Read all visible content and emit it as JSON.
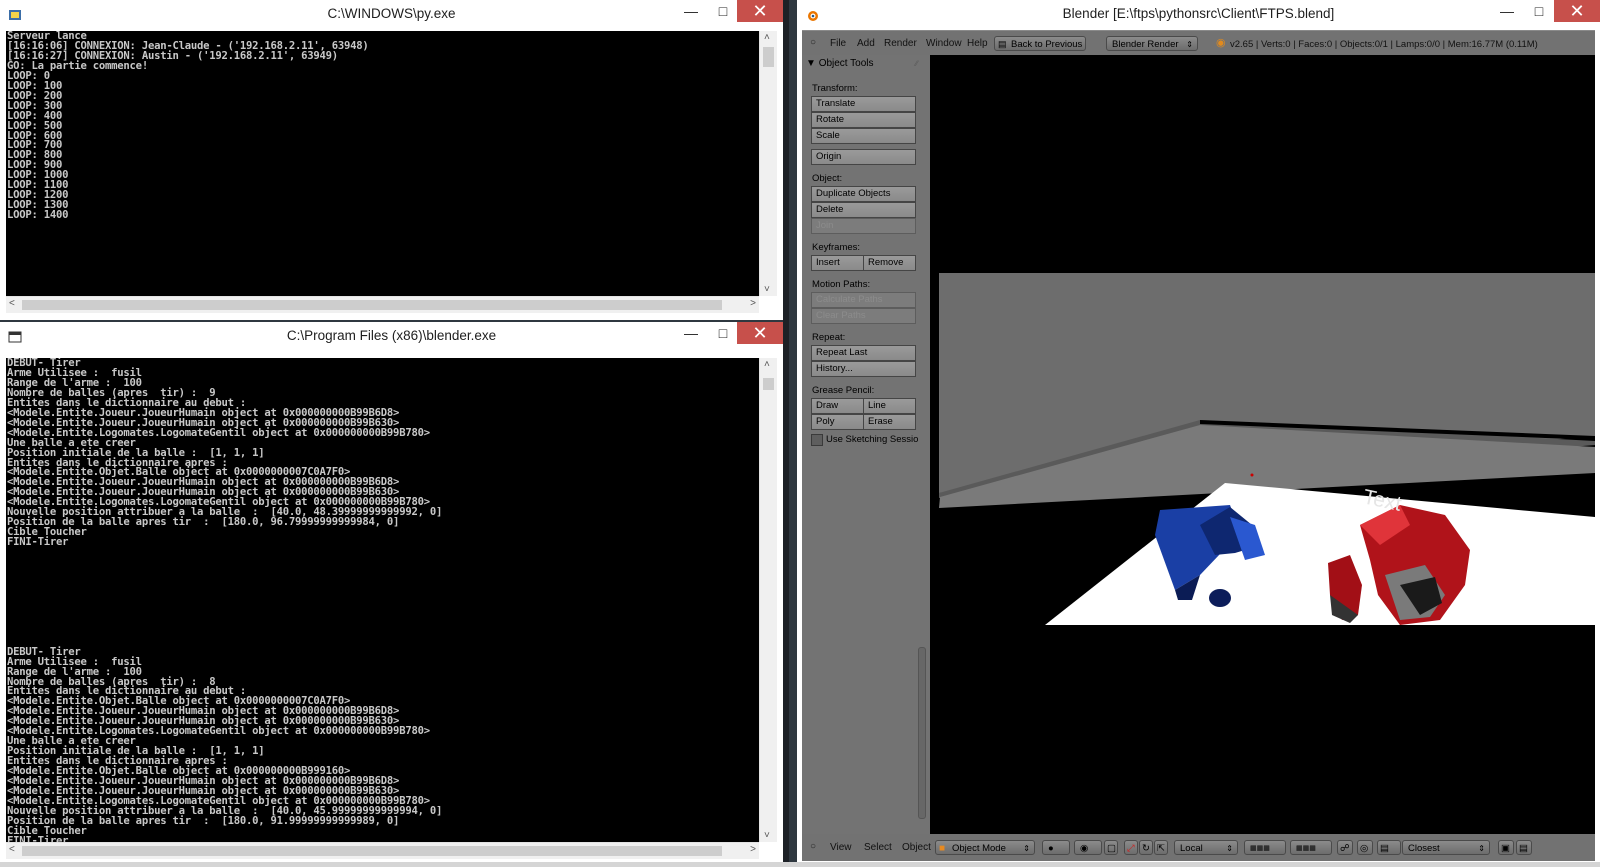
{
  "pywin": {
    "title": "C:\\WINDOWS\\py.exe",
    "lines": [
      "Serveur lance",
      "[16:16:06] CONNEXION: Jean-Claude - ('192.168.2.11', 63948)",
      "[16:16:27] CONNEXION: Austin - ('192.168.2.11', 63949)",
      "GO: La partie commence!",
      "LOOP: 0",
      "LOOP: 100",
      "LOOP: 200",
      "LOOP: 300",
      "LOOP: 400",
      "LOOP: 500",
      "LOOP: 600",
      "LOOP: 700",
      "LOOP: 800",
      "LOOP: 900",
      "LOOP: 1000",
      "LOOP: 1100",
      "LOOP: 1200",
      "LOOP: 1300",
      "LOOP: 1400"
    ]
  },
  "blenderexe": {
    "title": "C:\\Program Files (x86)\\blender.exe",
    "lines": [
      "DEBUT- Tirer",
      "Arme Utilisee :  fusil",
      "Range de l'arme :  100",
      "Nombre de balles (apres  tir) :  9",
      "Entites dans le dictionnaire au debut :",
      "<Modele.Entite.Joueur.JoueurHumain object at 0x000000000B99B6D8>",
      "<Modele.Entite.Joueur.JoueurHumain object at 0x000000000B99B630>",
      "<Modele.Entite.Logomates.LogomateGentil object at 0x000000000B99B780>",
      "Une balle a ete creer",
      "Position initiale de la balle :  [1, 1, 1]",
      "Entites dans le dictionnaire apres :",
      "<Modele.Entite.Objet.Balle object at 0x0000000007C0A7F0>",
      "<Modele.Entite.Joueur.JoueurHumain object at 0x000000000B99B6D8>",
      "<Modele.Entite.Joueur.JoueurHumain object at 0x000000000B99B630>",
      "<Modele.Entite.Logomates.LogomateGentil object at 0x000000000B99B780>",
      "Nouvelle position attribuer a la balle  :  [40.0, 48.39999999999992, 0]",
      "Position de la balle apres tir  :  [180.0, 96.79999999999984, 0]",
      "Cible Toucher",
      "FINI-Tirer",
      "",
      "",
      "",
      "",
      "",
      "",
      "",
      "",
      "",
      "",
      "DEBUT- Tirer",
      "Arme Utilisee :  fusil",
      "Range de l'arme :  100",
      "Nombre de balles (apres  tir) :  8",
      "Entites dans le dictionnaire au debut :",
      "<Modele.Entite.Objet.Balle object at 0x0000000007C0A7F0>",
      "<Modele.Entite.Joueur.JoueurHumain object at 0x000000000B99B6D8>",
      "<Modele.Entite.Joueur.JoueurHumain object at 0x000000000B99B630>",
      "<Modele.Entite.Logomates.LogomateGentil object at 0x000000000B99B780>",
      "Une balle a ete creer",
      "Position initiale de la balle :  [1, 1, 1]",
      "Entites dans le dictionnaire apres :",
      "<Modele.Entite.Objet.Balle object at 0x000000000B999160>",
      "<Modele.Entite.Joueur.JoueurHumain object at 0x000000000B99B6D8>",
      "<Modele.Entite.Joueur.JoueurHumain object at 0x000000000B99B630>",
      "<Modele.Entite.Logomates.LogomateGentil object at 0x000000000B99B780>",
      "Nouvelle position attribuer a la balle  :  [40.0, 45.99999999999994, 0]",
      "Position de la balle apres tir  :  [180.0, 91.99999999999989, 0]",
      "Cible Toucher",
      "FINI-Tirer"
    ]
  },
  "blender": {
    "title": "Blender [E:\\ftps\\pythonsrc\\Client\\FTPS.blend]",
    "menu": [
      "File",
      "Add",
      "Render",
      "Window",
      "Help"
    ],
    "back_button": "Back to Previous",
    "engine": "Blender Render",
    "stats": "v2.65 | Verts:0 | Faces:0 | Objects:0/1 | Lamps:0/0 | Mem:16.77M (0.11M)",
    "tools": {
      "header": "Object Tools",
      "transform_label": "Transform:",
      "translate": "Translate",
      "rotate": "Rotate",
      "scale": "Scale",
      "origin": "Origin",
      "object_label": "Object:",
      "duplicate": "Duplicate Objects",
      "delete": "Delete",
      "join": "Join",
      "keyframes_label": "Keyframes:",
      "insert": "Insert",
      "remove": "Remove",
      "motion_label": "Motion Paths:",
      "calc_paths": "Calculate Paths",
      "clear_paths": "Clear Paths",
      "repeat_label": "Repeat:",
      "repeat_last": "Repeat Last",
      "history": "History...",
      "grease_label": "Grease Pencil:",
      "draw": "Draw",
      "line": "Line",
      "poly": "Poly",
      "erase": "Erase",
      "sketch": "Use Sketching Sessio"
    },
    "viewport_text": "Text",
    "footer": {
      "view": "View",
      "select": "Select",
      "object": "Object",
      "mode": "Object Mode",
      "orientation": "Local",
      "snap": "Closest"
    }
  }
}
